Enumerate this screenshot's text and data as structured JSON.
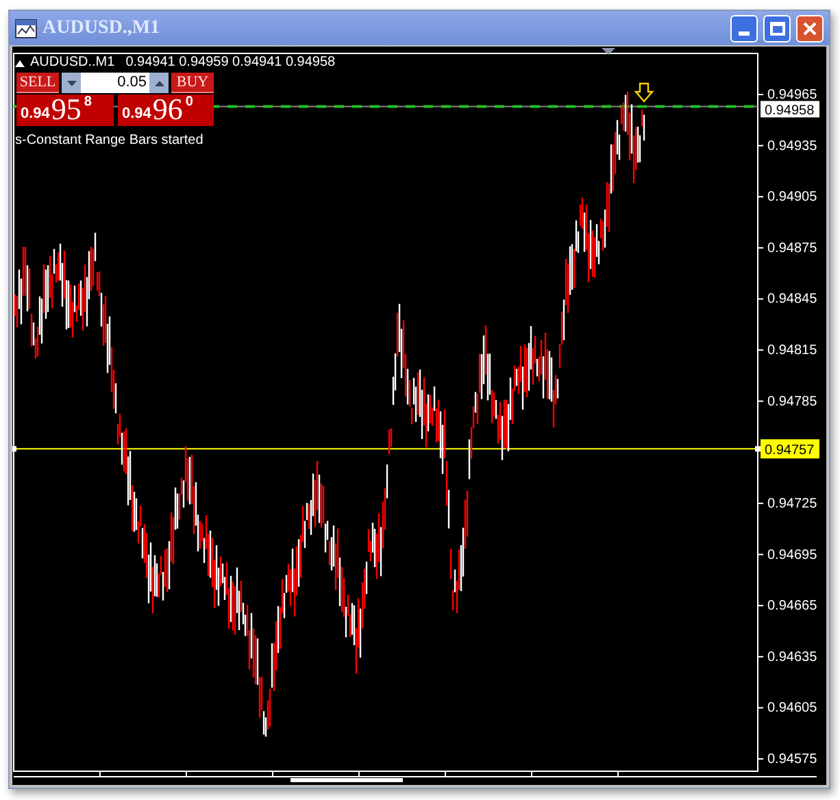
{
  "window": {
    "title": "AUDUSD.,M1"
  },
  "chart": {
    "symbol": "AUDUSD..M1",
    "ohlc": "0.94941 0.94959 0.94941 0.94958",
    "trade_panel": {
      "sell_label": "SELL",
      "buy_label": "BUY",
      "lot": "0.05",
      "bid": {
        "prefix": "0.94",
        "big": "95",
        "sup": "8"
      },
      "ask": {
        "prefix": "0.94",
        "big": "96",
        "sup": "0"
      }
    },
    "status_message": "s-Constant Range Bars started",
    "price_axis": {
      "ticks": [
        "0.94965",
        "0.94935",
        "0.94905",
        "0.94875",
        "0.94845",
        "0.94815",
        "0.94785",
        "0.94725",
        "0.94695",
        "0.94665",
        "0.94635",
        "0.94605",
        "0.94575"
      ],
      "current_price": "0.94958",
      "line_price": "0.94757"
    }
  }
}
